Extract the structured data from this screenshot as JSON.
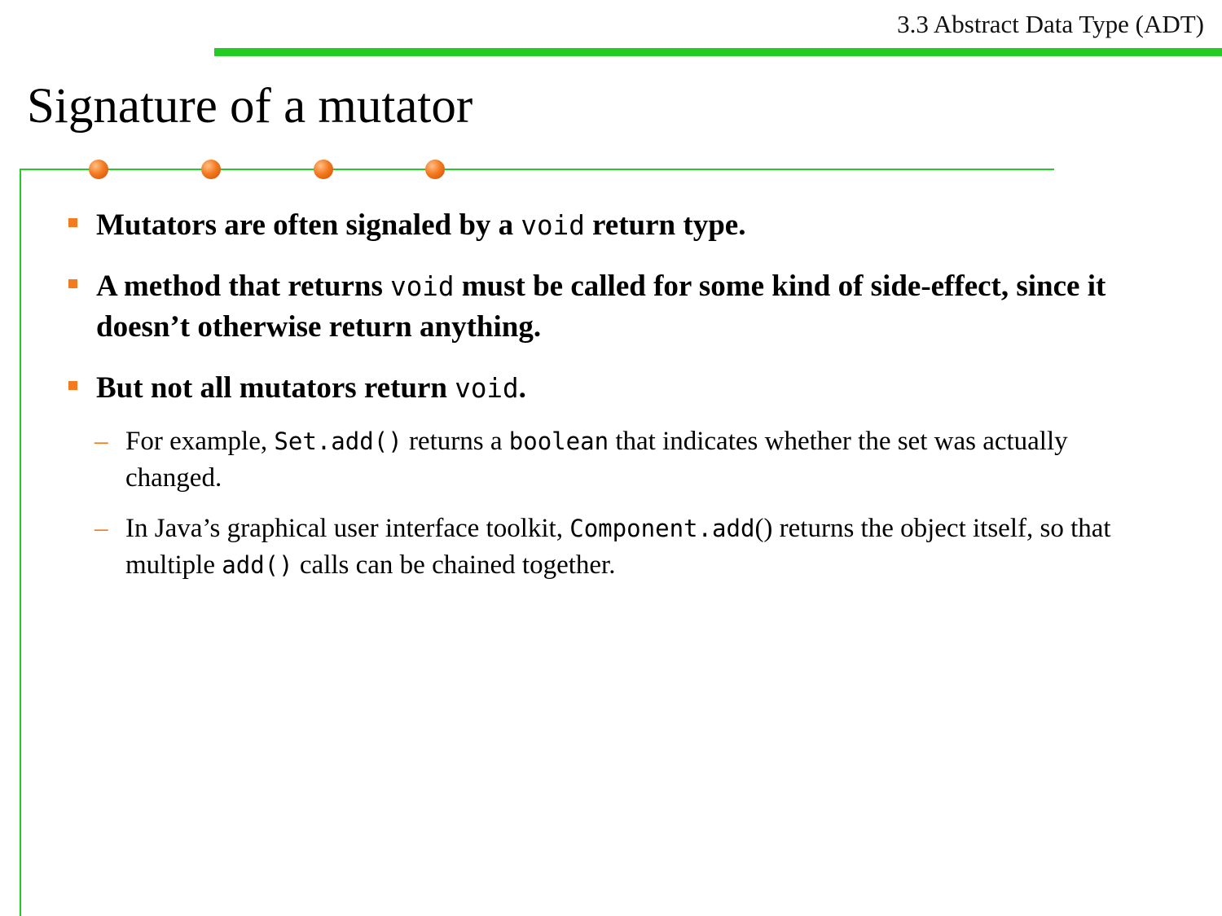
{
  "header": {
    "section": "3.3 Abstract Data Type (ADT)"
  },
  "slide": {
    "title": "Signature of a mutator"
  },
  "bullets": [
    {
      "pre": "Mutators are often signaled by a ",
      "code": "void",
      "post": " return type."
    },
    {
      "pre": "A method that returns ",
      "code": "void",
      "post": " must be called for some kind of side-effect, since it doesn’t otherwise return anything."
    },
    {
      "pre": "But not all mutators return ",
      "code": "void",
      "post": "."
    }
  ],
  "subbullets": [
    {
      "t1": "For example, ",
      "c1": "Set.add()",
      "t2": " returns a ",
      "c2": "boolean",
      "t3": " that indicates whether the set was actually changed."
    },
    {
      "t1": "In Java’s graphical user interface toolkit, ",
      "c1": "Component.add",
      "t2": "() returns the object itself, so that multiple ",
      "c2": "add()",
      "t3": " calls can be chained together."
    }
  ],
  "colors": {
    "accent_green": "#22cc22",
    "accent_orange": "#f47a20"
  }
}
